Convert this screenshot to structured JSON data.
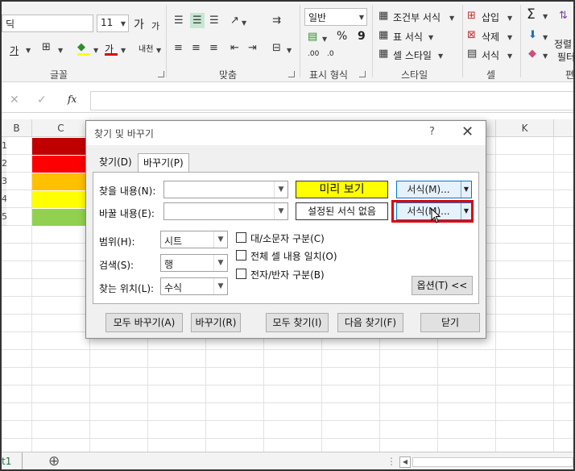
{
  "ribbon": {
    "font_name": "딕",
    "font_size": "11",
    "grow_font": "가",
    "shrink_font": "가",
    "underline_glyph": "가",
    "font_color_glyph": "가",
    "wrap_glyph": "내천",
    "number_format": "일반",
    "percent": "%",
    "comma": "9",
    "dec_inc": ".00",
    "dec_dec": ".0",
    "conditional_format": "조건부 서식",
    "table_format": "표 서식",
    "cell_style": "셀 스타일",
    "insert": "삽입",
    "delete": "삭제",
    "format": "서식",
    "sort_filter_1": "정렬",
    "sort_filter_2": "필터",
    "sigma": "Σ",
    "groups": {
      "font": "글꼴",
      "align": "맞춤",
      "number": "표시 형식",
      "style": "스타일",
      "cells": "셀",
      "edit": "편"
    }
  },
  "formula_bar": {
    "cancel": "✕",
    "enter": "✓",
    "fx": "fx",
    "value": ""
  },
  "grid": {
    "columns": [
      "B",
      "C",
      "K"
    ],
    "row_labels": [
      "1",
      "2",
      "3",
      "4",
      "5"
    ],
    "cell_colors": [
      "#c00000",
      "#ff0000",
      "#ffc000",
      "#ffff00",
      "#92d050"
    ]
  },
  "sheet_tab": {
    "label": "t1",
    "add": "⊕"
  },
  "dialog": {
    "title": "찾기 및 바꾸기",
    "help": "?",
    "close": "✕",
    "tabs": [
      "찾기(D)",
      "바꾸기(P)"
    ],
    "find_label": "찾을 내용(N):",
    "find_value": "",
    "replace_label": "바꿀 내용(E):",
    "replace_value": "",
    "preview_find": "미리 보기",
    "preview_replace": "설정된 서식 없음",
    "format_find": "서식(M)...",
    "format_replace": "서식(M)...",
    "within_label": "범위(H):",
    "within_value": "시트",
    "search_label": "검색(S):",
    "search_value": "행",
    "lookin_label": "찾는 위치(L):",
    "lookin_value": "수식",
    "opt_case": "대/소문자 구분(C)",
    "opt_entire": "전체 셀 내용 일치(O)",
    "opt_byte": "전자/반자 구분(B)",
    "options_btn": "옵션(T) <<",
    "btn_replace_all": "모두 바꾸기(A)",
    "btn_replace": "바꾸기(R)",
    "btn_find_all": "모두 찾기(I)",
    "btn_find_next": "다음 찾기(F)",
    "btn_close": "닫기"
  }
}
